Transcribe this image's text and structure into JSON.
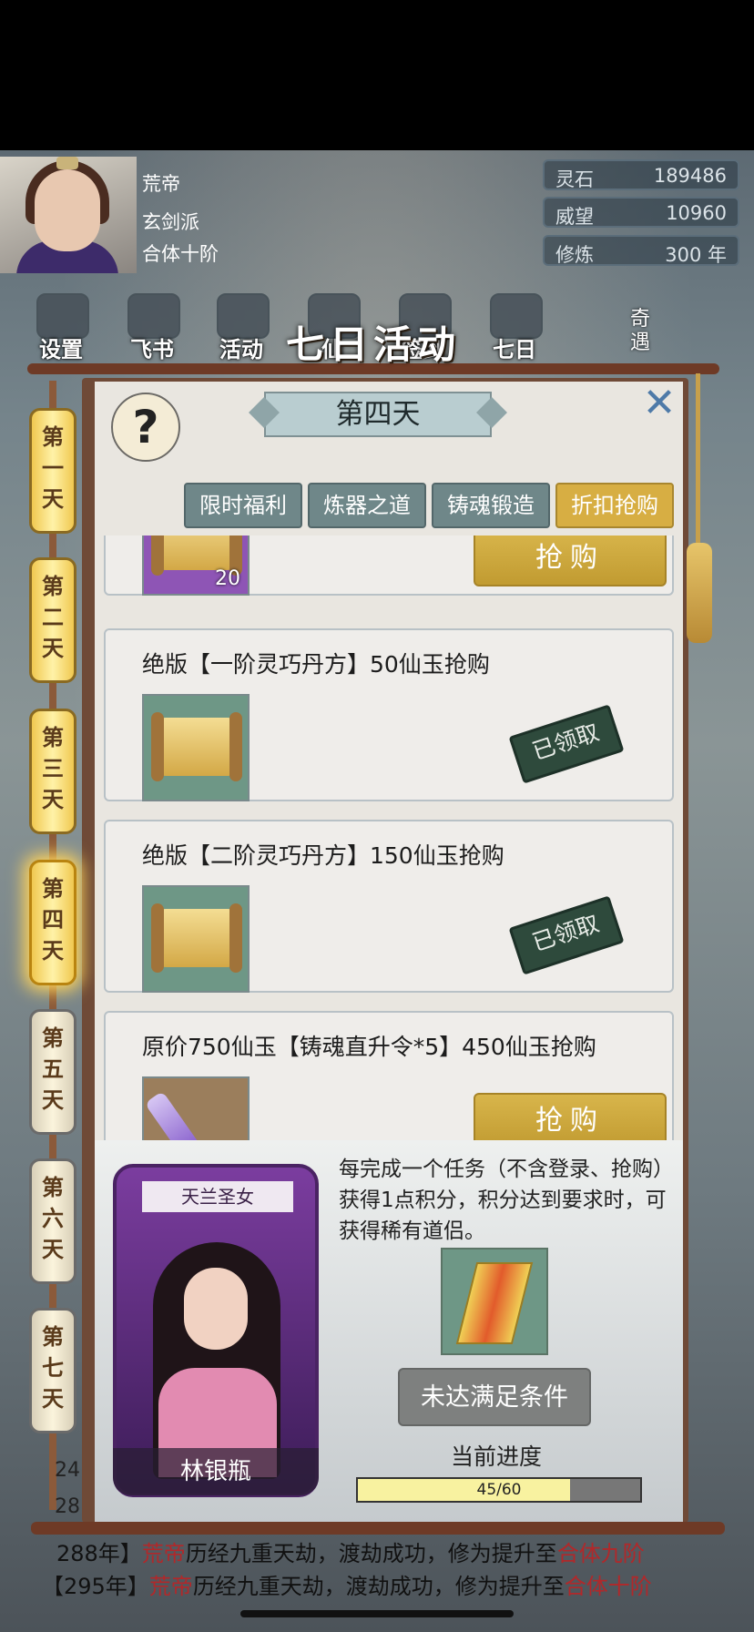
{
  "header": {
    "name": "荒帝",
    "sect": "玄剑派",
    "realm": "合体十阶",
    "stats": [
      {
        "label": "灵石",
        "value": "189486"
      },
      {
        "label": "威望",
        "value": "10960"
      },
      {
        "label": "修炼",
        "value": "300 年"
      }
    ]
  },
  "top_icons": [
    {
      "label": "设置",
      "icon": "gear-icon"
    },
    {
      "label": "飞书",
      "icon": "mail-icon"
    },
    {
      "label": "活动",
      "icon": "lantern-icon"
    },
    {
      "label": "仙",
      "icon": "gate-icon"
    },
    {
      "label": "签到",
      "icon": "temple-icon"
    },
    {
      "label": "七日",
      "icon": "gift-icon"
    }
  ],
  "side_icon_label": "奇遇",
  "title": "七日活动",
  "day_banner": "第四天",
  "tabs": [
    "限时福利",
    "炼器之道",
    "铸魂锻造",
    "折扣抢购"
  ],
  "active_tab": "折扣抢购",
  "days": [
    "第一天",
    "第二天",
    "第三天",
    "第四天",
    "第五天",
    "第六天",
    "第七天"
  ],
  "active_day": "第四天",
  "items": [
    {
      "title": "",
      "count": "20",
      "action": "抢购",
      "claimed": false
    },
    {
      "title": "绝版【一阶灵巧丹方】50仙玉抢购",
      "action": "已领取",
      "claimed": true
    },
    {
      "title": "绝版【二阶灵巧丹方】150仙玉抢购",
      "action": "已领取",
      "claimed": true
    },
    {
      "title": "原价750仙玉【铸魂直升令*5】450仙玉抢购",
      "action": "抢购",
      "claimed": false
    }
  ],
  "partner": {
    "title": "天兰圣女",
    "name": "林银瓶"
  },
  "description": "每完成一个任务（不含登录、抢购）获得1点积分，积分达到要求时，可获得稀有道侣。",
  "status_button": "未达满足条件",
  "progress": {
    "label": "当前进度",
    "current": 45,
    "total": 60,
    "text": "45/60"
  },
  "log": [
    {
      "year": "288年】",
      "name": "荒帝",
      "text": "历经九重天劫，渡劫成功，修为提升至",
      "realm": "合体九阶"
    },
    {
      "year": "【295年】",
      "name": "荒帝",
      "text": "历经九重天劫，渡劫成功，修为提升至",
      "realm": "合体十阶"
    }
  ],
  "log_side_numbers": [
    "24",
    "28"
  ]
}
